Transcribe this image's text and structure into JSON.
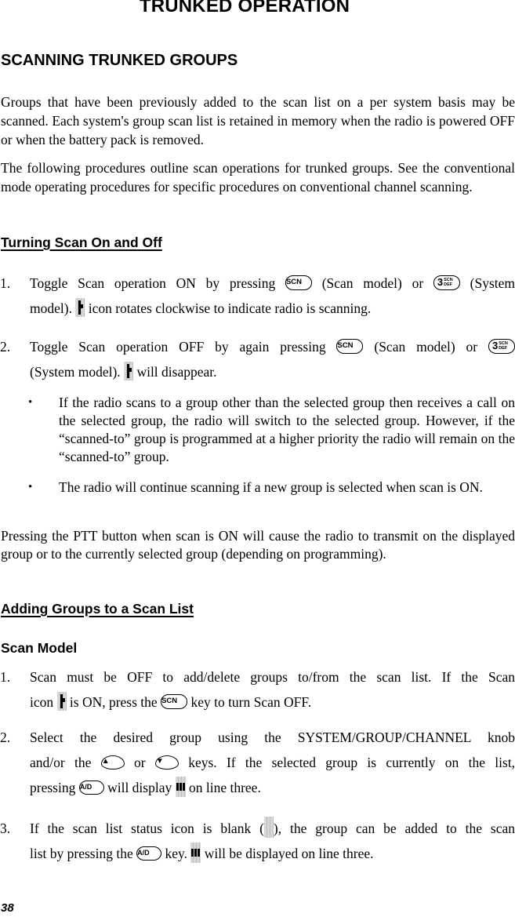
{
  "header": {
    "title": "TRUNKED OPERATION"
  },
  "section": {
    "title": "SCANNING TRUNKED GROUPS",
    "intro_paragraphs": [
      "Groups that have been previously added to the scan list on a per system basis may be scanned. Each system's group scan list is retained in memory when the radio is powered OFF or when the battery pack is removed.",
      "The following procedures outline scan operations for trunked groups. See the conventional mode operating procedures for specific procedures on conventional channel scanning."
    ]
  },
  "turning_scan": {
    "heading": "Turning Scan On and Off",
    "steps": [
      {
        "number": "1.",
        "line1_a": "Toggle Scan operation ON by pressing",
        "line1_b": "(Scan model) or",
        "line1_c": "(System",
        "line2_a": "model).",
        "line2_b": "icon rotates clockwise to indicate radio is scanning."
      },
      {
        "number": "2.",
        "line1_a": "Toggle Scan operation OFF by again pressing",
        "line1_b": "(Scan model) or",
        "line2_a": "(System model).",
        "line2_b": "will disappear."
      }
    ],
    "bullets": [
      "If the radio scans to a group other than the selected group then receives a call on the selected group, the radio will switch to the selected group.  However, if the “scanned-to” group is programmed at a higher priority the radio will remain on the “scanned-to” group.",
      "The radio will continue scanning if a new group is selected when scan is ON."
    ],
    "bullet_char": "•",
    "ptt_note": "Pressing the PTT button when scan is ON will cause the radio to transmit on the displayed group or to the currently selected group (depending on programming)."
  },
  "adding_groups": {
    "heading": "Adding Groups to a Scan List",
    "subheading": "Scan Model",
    "steps": [
      {
        "number": "1.",
        "line1": "Scan must be OFF to add/delete groups to/from the scan list. If the Scan",
        "line2_a": "icon",
        "line2_b": "is ON, press the",
        "line2_c": "key to turn Scan OFF."
      },
      {
        "number": "2.",
        "line1": "Select the desired group using the SYSTEM/GROUP/CHANNEL knob",
        "line2_a": "and/or the",
        "line2_b": "or",
        "line2_c": "keys. If the selected group is currently on the list,",
        "line3_a": "pressing",
        "line3_b": "will display",
        "line3_c": "on line three."
      },
      {
        "number": "3.",
        "line1_a": "If the scan list status icon is blank (",
        "line1_b": "), the group can be added to the scan",
        "line2_a": "list by pressing the",
        "line2_b": "key.",
        "line2_c": "will be displayed on line three."
      }
    ]
  },
  "keys": {
    "scn": "SCN",
    "three_big": "3",
    "three_small_top": "SCN",
    "three_small_bottom": "DEF",
    "ad": "A/D",
    "up": "▲",
    "down": "▼"
  },
  "footer": {
    "page_number": "38"
  }
}
